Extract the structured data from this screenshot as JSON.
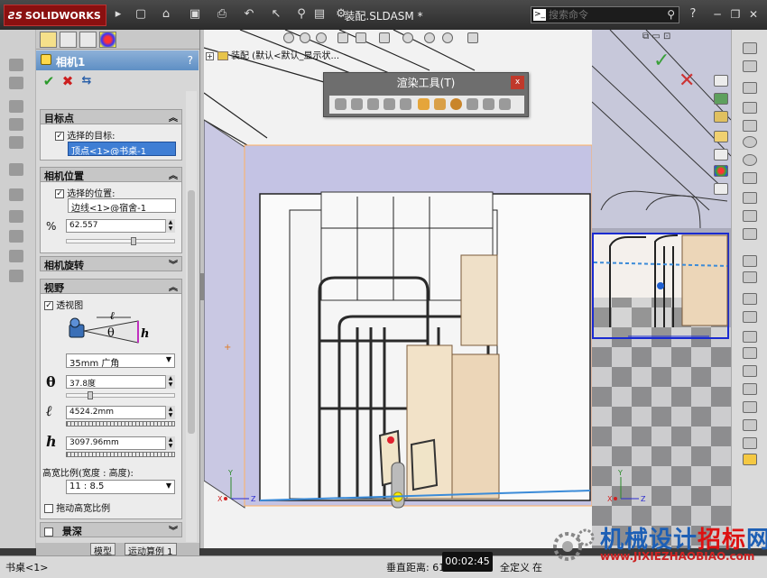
{
  "app": {
    "brand": "SOLIDWORKS",
    "document_title": "装配.SLDASM *",
    "search_placeholder": "搜索命令"
  },
  "property_manager": {
    "title": "相机1",
    "help": "?",
    "ok_icon": "check-icon",
    "cancel_icon": "x-icon",
    "detail_icon": "pushpin-icon",
    "target_section": {
      "title": "目标点",
      "checkbox_label": "选择的目标:",
      "checked": true,
      "selection": "顶点<1>@书桌-1"
    },
    "position_section": {
      "title": "相机位置",
      "checkbox_label": "选择的位置:",
      "checked": true,
      "selection": "边线<1>@宿舍-1",
      "percent_value": "62.557",
      "slider_fraction": 0.63
    },
    "rotation_section": {
      "title": "相机旋转"
    },
    "fov_section": {
      "title": "视野",
      "perspective_label": "透视图",
      "perspective_checked": true,
      "lens_option": "35mm 广角",
      "theta_symbol": "θ",
      "theta_value": "37.8度",
      "theta_slider_fraction": 0.2,
      "l_symbol": "ℓ",
      "l_value": "4524.2mm",
      "h_symbol": "h",
      "h_value": "3097.96mm",
      "aspect_label": "高宽比例(宽度 : 高度):",
      "aspect_value": "11 : 8.5",
      "drag_aspect_label": "拖动高宽比例",
      "drag_aspect_checked": false,
      "diagram_l": "ℓ",
      "diagram_theta": "θ",
      "diagram_h": "h"
    },
    "dof_section": {
      "title": "景深",
      "checked": false
    }
  },
  "bottom_tabs": [
    "模型",
    "运动算例 1"
  ],
  "tree_line": "装配  (默认<默认_显示状...",
  "render_toolbar": {
    "title": "渲染工具(T)",
    "close_label": "x"
  },
  "status_bar": {
    "left_text": "书桌<1>",
    "distance_text": "垂直距离: 610",
    "state_text": "全定义",
    "editing_text": "在"
  },
  "video_time": "00:02:45",
  "watermark": {
    "text_blue": "机械设计",
    "text_red": "招标",
    "text_blue2": "网",
    "url": "www.JIXIEZHAOBIAO.com"
  },
  "colors": {
    "title_bar": "#333333",
    "pm_header": "#6f9bcf",
    "selection_active": "#3f7ed4",
    "ok_green": "#2a9a2a",
    "cancel_red": "#cc1f1f",
    "camera_frame": "#1a2bd1"
  }
}
